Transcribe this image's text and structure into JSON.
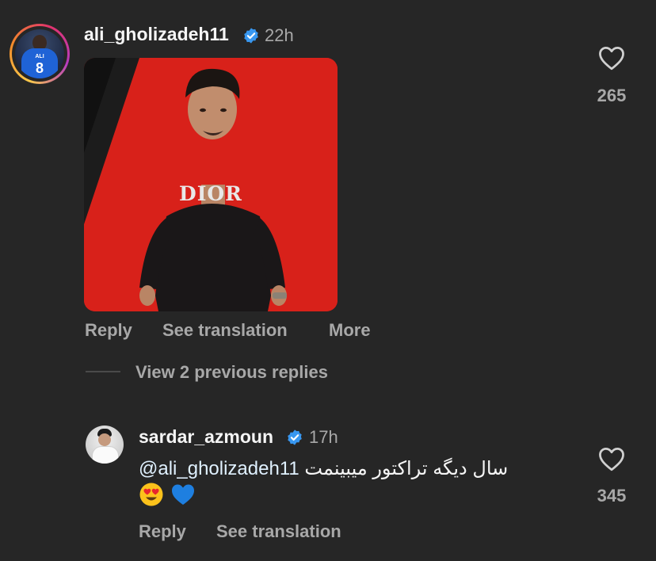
{
  "comment": {
    "username": "ali_gholizadeh11",
    "time": "22h",
    "jersey_name": "ALI",
    "jersey_number": "8",
    "gif_text": "DIOR",
    "likes": "265",
    "actions": {
      "reply": "Reply",
      "see_translation": "See translation",
      "more": "More"
    }
  },
  "view_replies": "View 2 previous replies",
  "reply": {
    "username": "sardar_azmoun",
    "time": "17h",
    "mention": "@ali_gholizadeh11",
    "text": "سال دیگه تراکتور میبینمت",
    "emojis": [
      "heart-eyes-icon",
      "blue-heart-icon"
    ],
    "likes": "345",
    "actions": {
      "reply": "Reply",
      "see_translation": "See translation"
    }
  },
  "colors": {
    "background": "#262626",
    "text": "#f5f5f5",
    "secondary_text": "#a8a8a8",
    "verified_badge": "#3897f0",
    "gif_background": "#d8211a",
    "blue_heart": "#1e7fe0"
  }
}
